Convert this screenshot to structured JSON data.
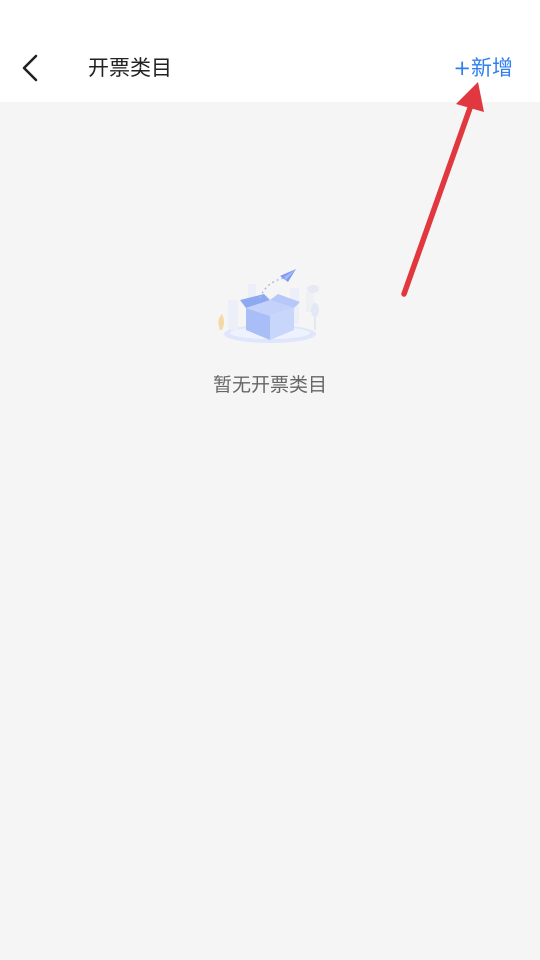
{
  "header": {
    "title": "开票类目",
    "add_label": "+新增",
    "back_icon": "chevron-left-icon"
  },
  "empty_state": {
    "message": "暂无开票类目",
    "illustration": "empty-box-illustration"
  },
  "colors": {
    "accent": "#2f7ff0",
    "background": "#f6f5f5",
    "header_bg": "#ffffff",
    "annotation": "#e0383e"
  }
}
